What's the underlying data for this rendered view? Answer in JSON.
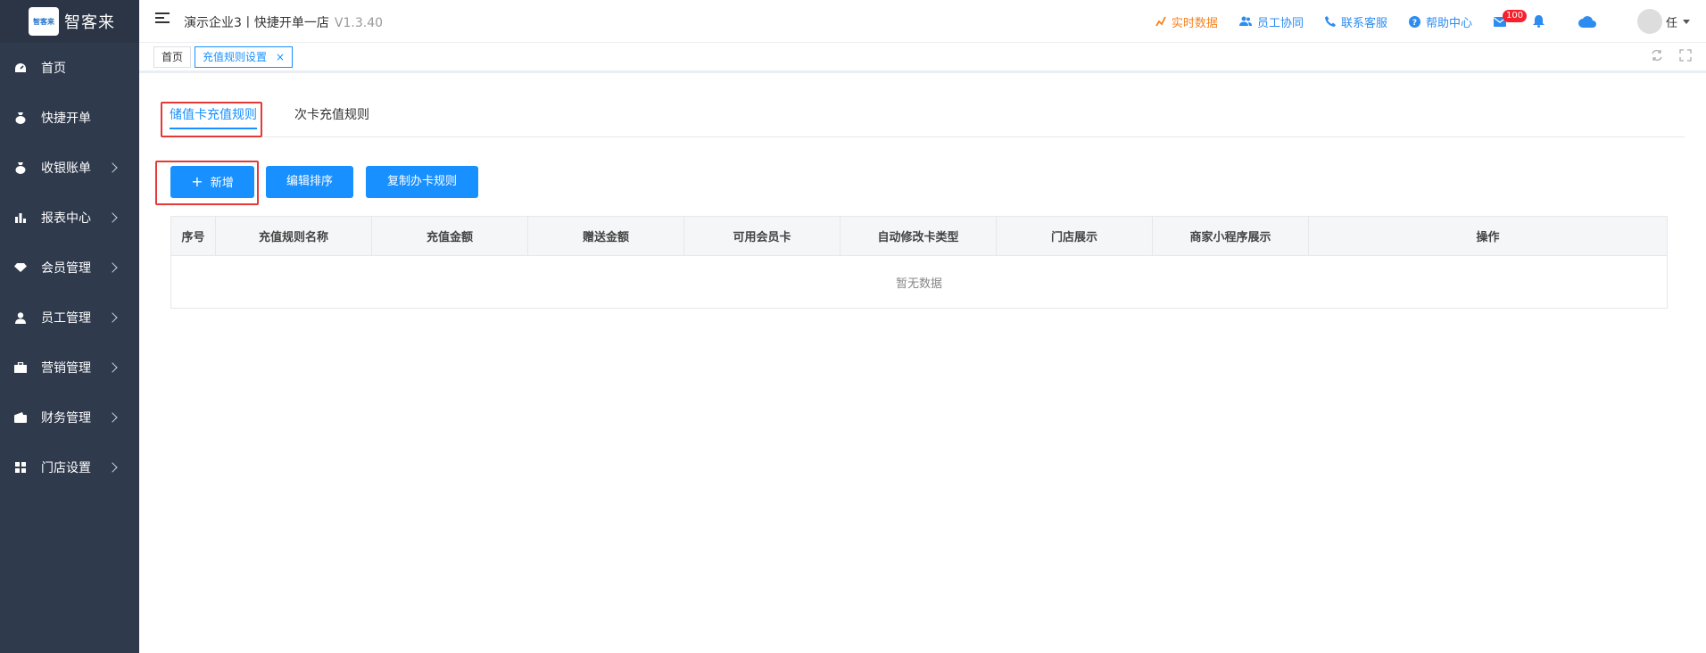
{
  "brand": {
    "logo_label": "智客来",
    "name": "智客来"
  },
  "sidebar": {
    "items": [
      {
        "label": "首页",
        "icon": "dashboard-icon",
        "chevron": false
      },
      {
        "label": "快捷开单",
        "icon": "money-bag-icon",
        "chevron": false
      },
      {
        "label": "收银账单",
        "icon": "money-bag-icon",
        "chevron": true
      },
      {
        "label": "报表中心",
        "icon": "bar-chart-icon",
        "chevron": true
      },
      {
        "label": "会员管理",
        "icon": "diamond-icon",
        "chevron": true
      },
      {
        "label": "员工管理",
        "icon": "user-icon",
        "chevron": true
      },
      {
        "label": "营销管理",
        "icon": "briefcase-icon",
        "chevron": true
      },
      {
        "label": "财务管理",
        "icon": "wallet-icon",
        "chevron": true
      },
      {
        "label": "门店设置",
        "icon": "grid-icon",
        "chevron": true
      }
    ]
  },
  "header": {
    "company": "演示企业3丨快捷开单一店",
    "version": "V1.3.40",
    "links": {
      "realtime": "实时数据",
      "collab": "员工协同",
      "support": "联系客服",
      "help": "帮助中心"
    },
    "mail_badge": "100",
    "user": "任"
  },
  "tabbar": {
    "home": "首页",
    "active": "充值规则设置",
    "close": "×"
  },
  "tabs": {
    "stored_card": "储值卡充值规则",
    "count_card": "次卡充值规则"
  },
  "buttons": {
    "add": "新增",
    "add_icon": "+",
    "sort": "编辑排序",
    "copy": "复制办卡规则"
  },
  "table": {
    "columns": [
      "序号",
      "充值规则名称",
      "充值金额",
      "赠送金额",
      "可用会员卡",
      "自动修改卡类型",
      "门店展示",
      "商家小程序展示",
      "操作"
    ],
    "empty_text": "暂无数据"
  },
  "colors": {
    "primary": "#1890ff",
    "sidebar": "#2f3a4c",
    "highlight": "#e53935",
    "orange": "#f5821f"
  }
}
